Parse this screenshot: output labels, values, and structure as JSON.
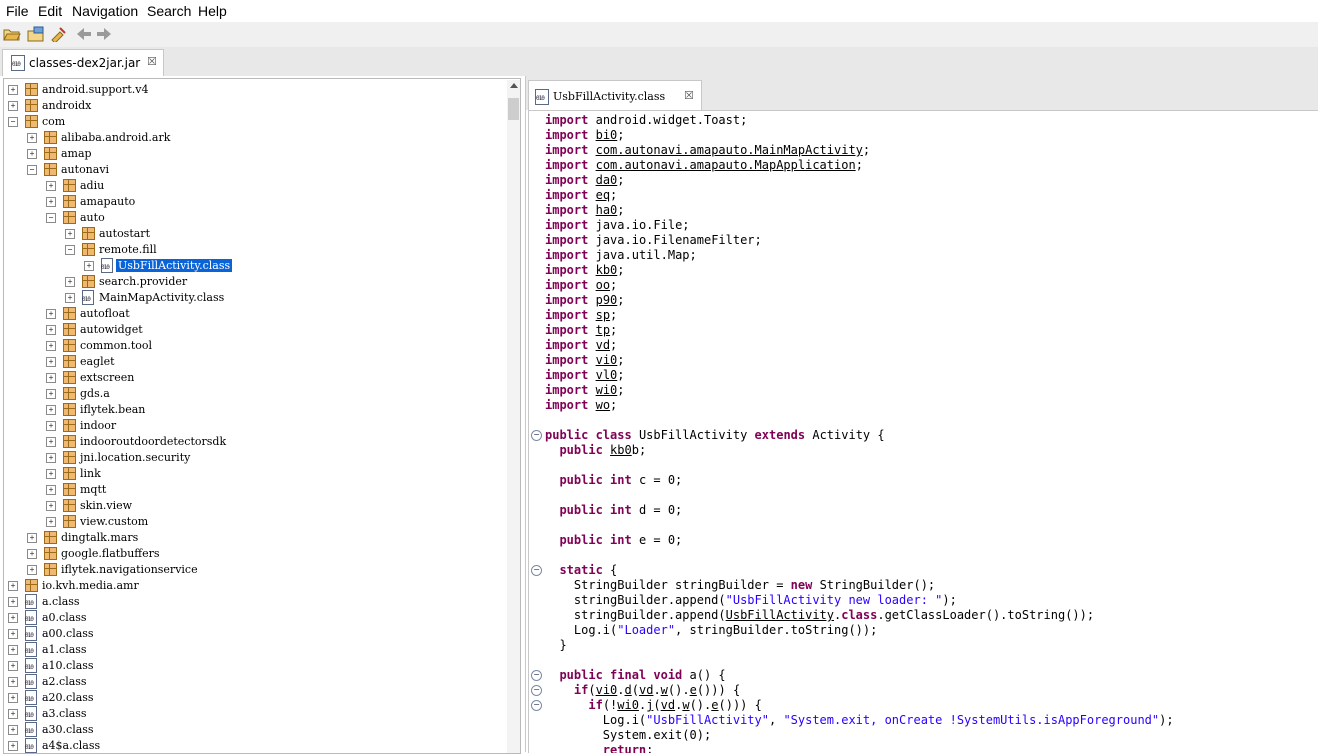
{
  "menu": [
    "File",
    "Edit",
    "Navigation",
    "Search",
    "Help"
  ],
  "toolbar": {
    "icons": [
      "open-folder-icon",
      "open-archive-icon",
      "sync-icon",
      "back-arrow-icon",
      "forward-arrow-icon"
    ]
  },
  "jar_tab": {
    "label": "classes-dex2jar.jar",
    "close": "☒"
  },
  "tree": [
    {
      "depth": 0,
      "expander": "+",
      "kind": "package",
      "label": "android.support.v4"
    },
    {
      "depth": 0,
      "expander": "+",
      "kind": "package",
      "label": "androidx"
    },
    {
      "depth": 0,
      "expander": "-",
      "kind": "package",
      "label": "com"
    },
    {
      "depth": 1,
      "expander": "+",
      "kind": "package",
      "label": "alibaba.android.ark"
    },
    {
      "depth": 1,
      "expander": "+",
      "kind": "package",
      "label": "amap"
    },
    {
      "depth": 1,
      "expander": "-",
      "kind": "package",
      "label": "autonavi"
    },
    {
      "depth": 2,
      "expander": "+",
      "kind": "package",
      "label": "adiu"
    },
    {
      "depth": 2,
      "expander": "+",
      "kind": "package",
      "label": "amapauto"
    },
    {
      "depth": 2,
      "expander": "-",
      "kind": "package",
      "label": "auto"
    },
    {
      "depth": 3,
      "expander": "+",
      "kind": "package",
      "label": "autostart"
    },
    {
      "depth": 3,
      "expander": "-",
      "kind": "package",
      "label": "remote.fill"
    },
    {
      "depth": 4,
      "expander": "+",
      "kind": "class",
      "label": "UsbFillActivity.class",
      "selected": true
    },
    {
      "depth": 3,
      "expander": "+",
      "kind": "package",
      "label": "search.provider"
    },
    {
      "depth": 3,
      "expander": "+",
      "kind": "class",
      "label": "MainMapActivity.class"
    },
    {
      "depth": 2,
      "expander": "+",
      "kind": "package",
      "label": "autofloat"
    },
    {
      "depth": 2,
      "expander": "+",
      "kind": "package",
      "label": "autowidget"
    },
    {
      "depth": 2,
      "expander": "+",
      "kind": "package",
      "label": "common.tool"
    },
    {
      "depth": 2,
      "expander": "+",
      "kind": "package",
      "label": "eaglet"
    },
    {
      "depth": 2,
      "expander": "+",
      "kind": "package",
      "label": "extscreen"
    },
    {
      "depth": 2,
      "expander": "+",
      "kind": "package",
      "label": "gds.a"
    },
    {
      "depth": 2,
      "expander": "+",
      "kind": "package",
      "label": "iflytek.bean"
    },
    {
      "depth": 2,
      "expander": "+",
      "kind": "package",
      "label": "indoor"
    },
    {
      "depth": 2,
      "expander": "+",
      "kind": "package",
      "label": "indooroutdoordetectorsdk"
    },
    {
      "depth": 2,
      "expander": "+",
      "kind": "package",
      "label": "jni.location.security"
    },
    {
      "depth": 2,
      "expander": "+",
      "kind": "package",
      "label": "link"
    },
    {
      "depth": 2,
      "expander": "+",
      "kind": "package",
      "label": "mqtt"
    },
    {
      "depth": 2,
      "expander": "+",
      "kind": "package",
      "label": "skin.view"
    },
    {
      "depth": 2,
      "expander": "+",
      "kind": "package",
      "label": "view.custom"
    },
    {
      "depth": 1,
      "expander": "+",
      "kind": "package",
      "label": "dingtalk.mars"
    },
    {
      "depth": 1,
      "expander": "+",
      "kind": "package",
      "label": "google.flatbuffers"
    },
    {
      "depth": 1,
      "expander": "+",
      "kind": "package",
      "label": "iflytek.navigationservice"
    },
    {
      "depth": 0,
      "expander": "+",
      "kind": "package",
      "label": "io.kvh.media.amr"
    },
    {
      "depth": 0,
      "expander": "+",
      "kind": "class",
      "label": "a.class"
    },
    {
      "depth": 0,
      "expander": "+",
      "kind": "class",
      "label": "a0.class"
    },
    {
      "depth": 0,
      "expander": "+",
      "kind": "class",
      "label": "a00.class"
    },
    {
      "depth": 0,
      "expander": "+",
      "kind": "class",
      "label": "a1.class"
    },
    {
      "depth": 0,
      "expander": "+",
      "kind": "class",
      "label": "a10.class"
    },
    {
      "depth": 0,
      "expander": "+",
      "kind": "class",
      "label": "a2.class"
    },
    {
      "depth": 0,
      "expander": "+",
      "kind": "class",
      "label": "a20.class"
    },
    {
      "depth": 0,
      "expander": "+",
      "kind": "class",
      "label": "a3.class"
    },
    {
      "depth": 0,
      "expander": "+",
      "kind": "class",
      "label": "a30.class"
    },
    {
      "depth": 0,
      "expander": "+",
      "kind": "class",
      "label": "a4$a.class"
    }
  ],
  "editor_tab": {
    "label": "UsbFillActivity.class",
    "close": "☒"
  },
  "code": [
    {
      "fold": "",
      "parts": [
        [
          "kw",
          "import"
        ],
        [
          "",
          "android.widget.Toast;"
        ]
      ]
    },
    {
      "fold": "",
      "parts": [
        [
          "kw",
          "import"
        ],
        [
          "u",
          "bi0"
        ],
        [
          "",
          ";"
        ]
      ]
    },
    {
      "fold": "",
      "parts": [
        [
          "kw",
          "import"
        ],
        [
          "u",
          "com.autonavi.amapauto.MainMapActivity"
        ],
        [
          "",
          ";"
        ]
      ]
    },
    {
      "fold": "",
      "parts": [
        [
          "kw",
          "import"
        ],
        [
          "u",
          "com.autonavi.amapauto.MapApplication"
        ],
        [
          "",
          ";"
        ]
      ]
    },
    {
      "fold": "",
      "parts": [
        [
          "kw",
          "import"
        ],
        [
          "u",
          "da0"
        ],
        [
          "",
          ";"
        ]
      ]
    },
    {
      "fold": "",
      "parts": [
        [
          "kw",
          "import"
        ],
        [
          "u",
          "eq"
        ],
        [
          "",
          ";"
        ]
      ]
    },
    {
      "fold": "",
      "parts": [
        [
          "kw",
          "import"
        ],
        [
          "u",
          "ha0"
        ],
        [
          "",
          ";"
        ]
      ]
    },
    {
      "fold": "",
      "parts": [
        [
          "kw",
          "import"
        ],
        [
          "",
          "java.io.File;"
        ]
      ]
    },
    {
      "fold": "",
      "parts": [
        [
          "kw",
          "import"
        ],
        [
          "",
          "java.io.FilenameFilter;"
        ]
      ]
    },
    {
      "fold": "",
      "parts": [
        [
          "kw",
          "import"
        ],
        [
          "",
          "java.util.Map;"
        ]
      ]
    },
    {
      "fold": "",
      "parts": [
        [
          "kw",
          "import"
        ],
        [
          "u",
          "kb0"
        ],
        [
          "",
          ";"
        ]
      ]
    },
    {
      "fold": "",
      "parts": [
        [
          "kw",
          "import"
        ],
        [
          "u",
          "oo"
        ],
        [
          "",
          ";"
        ]
      ]
    },
    {
      "fold": "",
      "parts": [
        [
          "kw",
          "import"
        ],
        [
          "u",
          "p90"
        ],
        [
          "",
          ";"
        ]
      ]
    },
    {
      "fold": "",
      "parts": [
        [
          "kw",
          "import"
        ],
        [
          "u",
          "sp"
        ],
        [
          "",
          ";"
        ]
      ]
    },
    {
      "fold": "",
      "parts": [
        [
          "kw",
          "import"
        ],
        [
          "u",
          "tp"
        ],
        [
          "",
          ";"
        ]
      ]
    },
    {
      "fold": "",
      "parts": [
        [
          "kw",
          "import"
        ],
        [
          "u",
          "vd"
        ],
        [
          "",
          ";"
        ]
      ]
    },
    {
      "fold": "",
      "parts": [
        [
          "kw",
          "import"
        ],
        [
          "u",
          "vi0"
        ],
        [
          "",
          ";"
        ]
      ]
    },
    {
      "fold": "",
      "parts": [
        [
          "kw",
          "import"
        ],
        [
          "u",
          "vl0"
        ],
        [
          "",
          ";"
        ]
      ]
    },
    {
      "fold": "",
      "parts": [
        [
          "kw",
          "import"
        ],
        [
          "u",
          "wi0"
        ],
        [
          "",
          ";"
        ]
      ]
    },
    {
      "fold": "",
      "parts": [
        [
          "kw",
          "import"
        ],
        [
          "u",
          "wo"
        ],
        [
          "",
          ";"
        ]
      ]
    },
    {
      "fold": "",
      "parts": []
    },
    {
      "fold": "-",
      "parts": [
        [
          "kw",
          "public class"
        ],
        [
          "",
          "UsbFillActivity"
        ],
        [
          "kw",
          "extends"
        ],
        [
          "",
          "Activity {"
        ]
      ]
    },
    {
      "fold": "",
      "parts": [
        [
          "",
          "  "
        ],
        [
          "kw",
          "public"
        ],
        [
          "u",
          "kb0"
        ],
        [
          "",
          "b;"
        ]
      ]
    },
    {
      "fold": "",
      "parts": []
    },
    {
      "fold": "",
      "parts": [
        [
          "",
          "  "
        ],
        [
          "kw",
          "public int"
        ],
        [
          "",
          "c = 0;"
        ]
      ]
    },
    {
      "fold": "",
      "parts": []
    },
    {
      "fold": "",
      "parts": [
        [
          "",
          "  "
        ],
        [
          "kw",
          "public int"
        ],
        [
          "",
          "d = 0;"
        ]
      ]
    },
    {
      "fold": "",
      "parts": []
    },
    {
      "fold": "",
      "parts": [
        [
          "",
          "  "
        ],
        [
          "kw",
          "public int"
        ],
        [
          "",
          "e = 0;"
        ]
      ]
    },
    {
      "fold": "",
      "parts": []
    },
    {
      "fold": "-",
      "parts": [
        [
          "",
          "  "
        ],
        [
          "kw",
          "static"
        ],
        [
          "",
          "{"
        ]
      ]
    },
    {
      "fold": "",
      "parts": [
        [
          "",
          "    StringBuilder stringBuilder = "
        ],
        [
          "kw",
          "new"
        ],
        [
          "",
          "StringBuilder();"
        ]
      ]
    },
    {
      "fold": "",
      "parts": [
        [
          "",
          "    stringBuilder.append("
        ],
        [
          "str",
          "\"UsbFillActivity new loader: \""
        ],
        [
          "",
          ");"
        ]
      ]
    },
    {
      "fold": "",
      "parts": [
        [
          "",
          "    stringBuilder.append("
        ],
        [
          "u",
          "UsbFillActivity"
        ],
        [
          "",
          "."
        ],
        [
          "kw",
          "class"
        ],
        [
          "",
          ".getClassLoader().toString());"
        ]
      ]
    },
    {
      "fold": "",
      "parts": [
        [
          "",
          "    Log.i("
        ],
        [
          "str",
          "\"Loader\""
        ],
        [
          "",
          ", stringBuilder.toString());"
        ]
      ]
    },
    {
      "fold": "",
      "parts": [
        [
          "",
          "  }"
        ]
      ]
    },
    {
      "fold": "",
      "parts": []
    },
    {
      "fold": "-",
      "parts": [
        [
          "",
          "  "
        ],
        [
          "kw",
          "public final void"
        ],
        [
          "",
          "a() {"
        ]
      ]
    },
    {
      "fold": "-",
      "parts": [
        [
          "",
          "    "
        ],
        [
          "kw",
          "if"
        ],
        [
          "",
          "("
        ],
        [
          "u",
          "vi0"
        ],
        [
          "",
          "."
        ],
        [
          "u",
          "d"
        ],
        [
          "",
          "("
        ],
        [
          "u",
          "vd"
        ],
        [
          "",
          "."
        ],
        [
          "u",
          "w"
        ],
        [
          "",
          "()."
        ],
        [
          "u",
          "e"
        ],
        [
          "",
          "())) {"
        ]
      ]
    },
    {
      "fold": "-",
      "parts": [
        [
          "",
          "      "
        ],
        [
          "kw",
          "if"
        ],
        [
          "",
          "(!"
        ],
        [
          "u",
          "wi0"
        ],
        [
          "",
          "."
        ],
        [
          "u",
          "j"
        ],
        [
          "",
          "("
        ],
        [
          "u",
          "vd"
        ],
        [
          "",
          "."
        ],
        [
          "u",
          "w"
        ],
        [
          "",
          "()."
        ],
        [
          "u",
          "e"
        ],
        [
          "",
          "())) {"
        ]
      ]
    },
    {
      "fold": "",
      "parts": [
        [
          "",
          "        Log.i("
        ],
        [
          "str",
          "\"UsbFillActivity\""
        ],
        [
          "",
          ", "
        ],
        [
          "str",
          "\"System.exit, onCreate !SystemUtils.isAppForeground\""
        ],
        [
          "",
          ");"
        ]
      ]
    },
    {
      "fold": "",
      "parts": [
        [
          "",
          "        System.exit(0);"
        ]
      ]
    },
    {
      "fold": "",
      "parts": [
        [
          "",
          "        "
        ],
        [
          "kw",
          "return"
        ],
        [
          "",
          ";"
        ]
      ]
    }
  ]
}
